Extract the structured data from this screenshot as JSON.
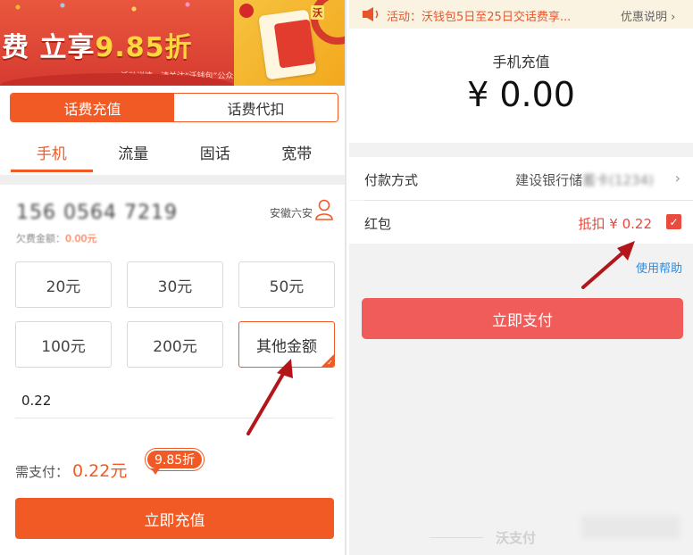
{
  "colors": {
    "accent": "#f15a24",
    "pay_button": "#f05c5a",
    "link": "#2d8bdc",
    "notice_bg": "#fbf3e1"
  },
  "left": {
    "banner": {
      "headline_prefix": "费 立享",
      "headline_highlight": "9.85折",
      "sub": "活动详情，请关注“沃钱包”公众号",
      "partner_badge": "沃"
    },
    "segments": [
      {
        "label": "话费充值",
        "active": true
      },
      {
        "label": "话费代扣",
        "active": false
      }
    ],
    "tabs": [
      "手机",
      "流量",
      "固话",
      "宽带"
    ],
    "phone_number": "156 0564 7219",
    "region": "安徽六安",
    "owe_label": "欠费金额：",
    "owe_amount": "0.00元",
    "amounts": [
      "20元",
      "30元",
      "50元",
      "100元",
      "200元",
      "其他金额"
    ],
    "selected_amount": "其他金额",
    "custom_value": "0.22",
    "need_pay_label": "需支付：",
    "need_pay_value": "0.22元",
    "discount_badge": "9.85折",
    "submit": "立即充值"
  },
  "right": {
    "notice": "活动：沃钱包5日至25日交话费享...",
    "notice_link": "优惠说明",
    "pay_title": "手机充值",
    "pay_amount": "¥ 0.00",
    "method_label": "付款方式",
    "method_value": "建设银行储",
    "method_masked": "蓄卡(1234)",
    "hongbao_label": "红包",
    "hongbao_value": "抵扣 ¥ 0.22",
    "help": "使用帮助",
    "pay_button": "立即支付",
    "watermark": "沃支付"
  }
}
